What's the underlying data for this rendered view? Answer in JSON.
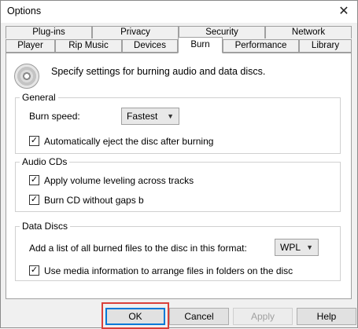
{
  "window": {
    "title": "Options",
    "close_icon": "close-icon"
  },
  "tabs": {
    "row1": [
      "Plug-ins",
      "Privacy",
      "Security",
      "Network"
    ],
    "row2": [
      "Player",
      "Rip Music",
      "Devices",
      "Burn",
      "Performance",
      "Library"
    ],
    "active": "Burn"
  },
  "panel": {
    "description": "Specify settings for burning audio and data discs.",
    "general": {
      "legend": "General",
      "burn_speed_label": "Burn speed:",
      "burn_speed_value": "Fastest",
      "auto_eject_label": "Automatically eject the disc after burning",
      "auto_eject_checked": true
    },
    "audio": {
      "legend": "Audio CDs",
      "volume_leveling_label": "Apply volume leveling across tracks",
      "volume_leveling_checked": true,
      "no_gaps_label": "Burn CD without gaps b",
      "no_gaps_checked": true
    },
    "data": {
      "legend": "Data Discs",
      "format_label": "Add a list of all burned files to the disc in this format:",
      "format_value": "WPL",
      "media_info_label": "Use media information to arrange files in folders on the disc",
      "media_info_checked": true
    }
  },
  "buttons": {
    "ok": "OK",
    "cancel": "Cancel",
    "apply": "Apply",
    "help": "Help"
  },
  "colors": {
    "focus_blue": "#0078d7",
    "highlight_red": "#d9403a"
  }
}
